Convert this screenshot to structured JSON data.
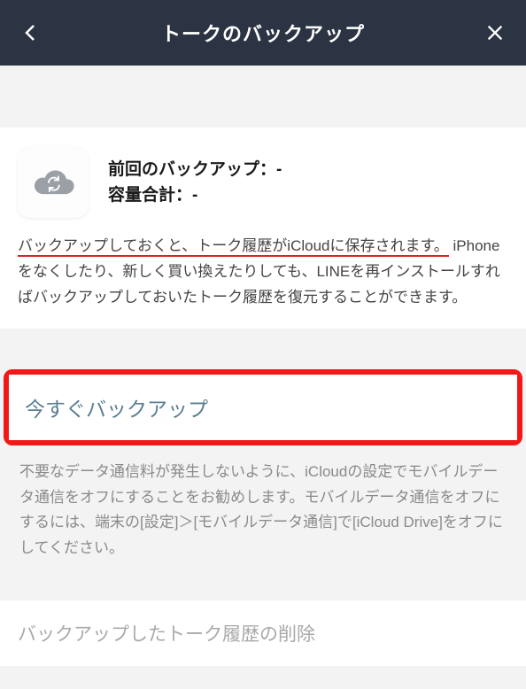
{
  "navbar": {
    "title": "トークのバックアップ"
  },
  "info": {
    "line1": "前回のバックアップ：-",
    "line2": "容量合計：-",
    "redline": "バックアップしておくと、トーク履歴がiCloudに保存されます。",
    "body_rest": "iPhoneをなくしたり、新しく買い換えたりしても、LINEを再インストールすればバックアップしておいたトーク履歴を復元することができます。"
  },
  "backup": {
    "button_label": "今すぐバックアップ",
    "note": "不要なデータ通信料が発生しないように、iCloudの設定でモバイルデータ通信をオフにすることをお勧めします。モバイルデータ通信をオフにするには、端末の[設定]＞[モバイルデータ通信]で[iCloud Drive]をオフにしてください。"
  },
  "delete": {
    "label": "バックアップしたトーク履歴の削除"
  }
}
